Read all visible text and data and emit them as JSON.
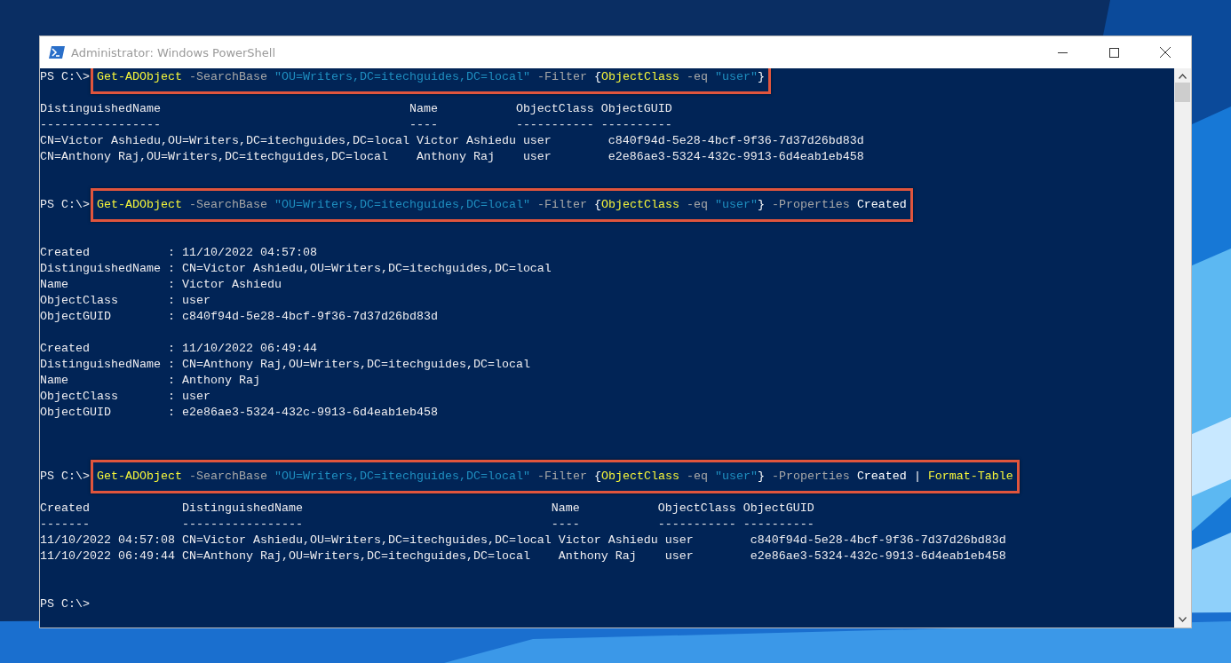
{
  "window": {
    "title": "Administrator: Windows PowerShell"
  },
  "console": {
    "lines": [
      {
        "kind": "command",
        "highlighted": true,
        "prompt": "PS C:\\>",
        "words": [
          [
            {
              "kind": "cmdlet",
              "text": "Get-ADObject"
            }
          ],
          [
            {
              "kind": "param",
              "text": "-SearchBase"
            }
          ],
          [
            {
              "kind": "string",
              "text": "\"OU=Writers,DC=itechguides,DC=local\""
            }
          ],
          [
            {
              "kind": "param",
              "text": "-Filter"
            }
          ],
          [
            {
              "kind": "plain",
              "text": "{"
            },
            {
              "kind": "member",
              "text": "ObjectClass"
            }
          ],
          [
            {
              "kind": "param",
              "text": "-eq"
            }
          ],
          [
            {
              "kind": "string",
              "text": "\"user\""
            },
            {
              "kind": "plain",
              "text": "}"
            }
          ]
        ]
      },
      {
        "kind": "blank"
      },
      {
        "kind": "output",
        "text": "DistinguishedName                                   Name           ObjectClass ObjectGUID"
      },
      {
        "kind": "output",
        "text": "-----------------                                   ----           ----------- ----------"
      },
      {
        "kind": "output",
        "text": "CN=Victor Ashiedu,OU=Writers,DC=itechguides,DC=local Victor Ashiedu user        c840f94d-5e28-4bcf-9f36-7d37d26bd83d"
      },
      {
        "kind": "output",
        "text": "CN=Anthony Raj,OU=Writers,DC=itechguides,DC=local    Anthony Raj    user        e2e86ae3-5324-432c-9913-6d4eab1eb458"
      },
      {
        "kind": "blank"
      },
      {
        "kind": "blank"
      },
      {
        "kind": "command",
        "highlighted": true,
        "prompt": "PS C:\\>",
        "words": [
          [
            {
              "kind": "cmdlet",
              "text": "Get-ADObject"
            }
          ],
          [
            {
              "kind": "param",
              "text": "-SearchBase"
            }
          ],
          [
            {
              "kind": "string",
              "text": "\"OU=Writers,DC=itechguides,DC=local\""
            }
          ],
          [
            {
              "kind": "param",
              "text": "-Filter"
            }
          ],
          [
            {
              "kind": "plain",
              "text": "{"
            },
            {
              "kind": "member",
              "text": "ObjectClass"
            }
          ],
          [
            {
              "kind": "param",
              "text": "-eq"
            }
          ],
          [
            {
              "kind": "string",
              "text": "\"user\""
            },
            {
              "kind": "plain",
              "text": "}"
            }
          ],
          [
            {
              "kind": "param",
              "text": "-Properties"
            }
          ],
          [
            {
              "kind": "plain",
              "text": "Created"
            }
          ]
        ]
      },
      {
        "kind": "blank"
      },
      {
        "kind": "blank"
      },
      {
        "kind": "output",
        "text": "Created           : 11/10/2022 04:57:08"
      },
      {
        "kind": "output",
        "text": "DistinguishedName : CN=Victor Ashiedu,OU=Writers,DC=itechguides,DC=local"
      },
      {
        "kind": "output",
        "text": "Name              : Victor Ashiedu"
      },
      {
        "kind": "output",
        "text": "ObjectClass       : user"
      },
      {
        "kind": "output",
        "text": "ObjectGUID        : c840f94d-5e28-4bcf-9f36-7d37d26bd83d"
      },
      {
        "kind": "blank"
      },
      {
        "kind": "output",
        "text": "Created           : 11/10/2022 06:49:44"
      },
      {
        "kind": "output",
        "text": "DistinguishedName : CN=Anthony Raj,OU=Writers,DC=itechguides,DC=local"
      },
      {
        "kind": "output",
        "text": "Name              : Anthony Raj"
      },
      {
        "kind": "output",
        "text": "ObjectClass       : user"
      },
      {
        "kind": "output",
        "text": "ObjectGUID        : e2e86ae3-5324-432c-9913-6d4eab1eb458"
      },
      {
        "kind": "blank"
      },
      {
        "kind": "blank"
      },
      {
        "kind": "blank"
      },
      {
        "kind": "command",
        "highlighted": true,
        "prompt": "PS C:\\>",
        "words": [
          [
            {
              "kind": "cmdlet",
              "text": "Get-ADObject"
            }
          ],
          [
            {
              "kind": "param",
              "text": "-SearchBase"
            }
          ],
          [
            {
              "kind": "string",
              "text": "\"OU=Writers,DC=itechguides,DC=local\""
            }
          ],
          [
            {
              "kind": "param",
              "text": "-Filter"
            }
          ],
          [
            {
              "kind": "plain",
              "text": "{"
            },
            {
              "kind": "member",
              "text": "ObjectClass"
            }
          ],
          [
            {
              "kind": "param",
              "text": "-eq"
            }
          ],
          [
            {
              "kind": "string",
              "text": "\"user\""
            },
            {
              "kind": "plain",
              "text": "}"
            }
          ],
          [
            {
              "kind": "param",
              "text": "-Properties"
            }
          ],
          [
            {
              "kind": "plain",
              "text": "Created"
            }
          ],
          [
            {
              "kind": "plain",
              "text": "|"
            }
          ],
          [
            {
              "kind": "cmdlet",
              "text": "Format-Table"
            }
          ]
        ]
      },
      {
        "kind": "blank"
      },
      {
        "kind": "output",
        "text": "Created             DistinguishedName                                   Name           ObjectClass ObjectGUID"
      },
      {
        "kind": "output",
        "text": "-------             -----------------                                   ----           ----------- ----------"
      },
      {
        "kind": "output",
        "text": "11/10/2022 04:57:08 CN=Victor Ashiedu,OU=Writers,DC=itechguides,DC=local Victor Ashiedu user        c840f94d-5e28-4bcf-9f36-7d37d26bd83d"
      },
      {
        "kind": "output",
        "text": "11/10/2022 06:49:44 CN=Anthony Raj,OU=Writers,DC=itechguides,DC=local    Anthony Raj    user        e2e86ae3-5324-432c-9913-6d4eab1eb458"
      },
      {
        "kind": "blank"
      },
      {
        "kind": "blank"
      },
      {
        "kind": "prompt",
        "prompt": "PS C:\\>"
      }
    ]
  }
}
